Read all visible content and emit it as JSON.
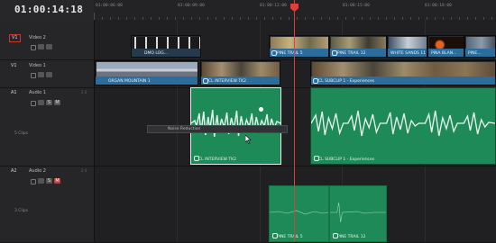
{
  "timecode": "01:00:14:18",
  "ruler": {
    "labels": [
      "01:00:06:00",
      "01:00:09:00",
      "01:00:12:00",
      "01:00:15:00",
      "01:00:18:00"
    ]
  },
  "tracks": {
    "v2": {
      "id": "V1",
      "name": "Video 2"
    },
    "v1": {
      "id": "V1",
      "name": "Video 1"
    },
    "a1": {
      "id": "A1",
      "name": "Audio 1",
      "channels": "2.0",
      "clip_count": "5 Clips",
      "solo": "S",
      "mute": "M"
    },
    "a2": {
      "id": "A2",
      "name": "Audio 2",
      "channels": "2.0",
      "clip_count": "3 Clips",
      "solo": "S",
      "mute": "M"
    }
  },
  "clips": {
    "v2_clip1": "DMO LOG...",
    "v2_clip2": "PINE TRAIL 5",
    "v2_clip3": "PINE TRAIL 12",
    "v2_clip4": "WHITE SANDS 11",
    "v2_clip5": "PINA BLAN...",
    "v2_clip6": "PINE...",
    "v1_clip1": "ORGAN MOUNTAIN 1",
    "v1_clip2": "CL INTERVIEW TK2",
    "v1_clip3": "CL SUBCLIP 1 - Experiences",
    "a1_clip1": "CL INTERVIEW TK2",
    "a1_clip2": "CL SUBCLIP 1 - Experiences",
    "a2_clip1": "PINE TRAIL 5",
    "a2_clip2": "PINE TRAIL 12"
  },
  "tooltip": "Noise Reduction",
  "colors": {
    "video_bar": "#2b6e9d",
    "audio_clip": "#1e8a57",
    "playhead": "#e53a3a",
    "mute": "#c93b33"
  }
}
